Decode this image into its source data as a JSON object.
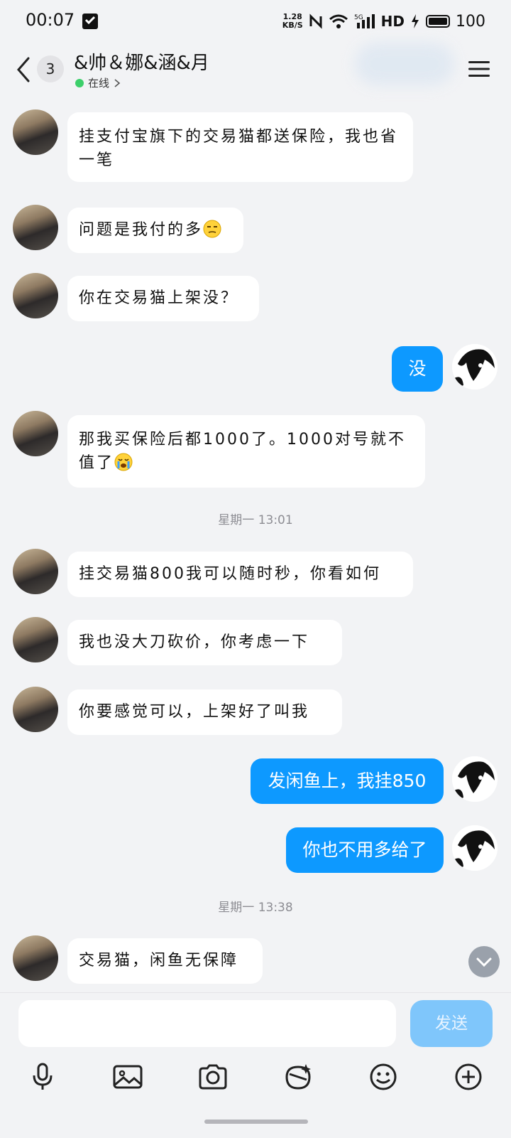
{
  "status_bar": {
    "time": "00:07",
    "net_speed_value": "1.28",
    "net_speed_unit": "KB/S",
    "network": "5G",
    "hd": "HD",
    "battery": "100"
  },
  "header": {
    "back_count": "3",
    "title": "&帅＆娜&涵&月",
    "presence": "在线",
    "status_color": "#3ccf6a"
  },
  "messages": [
    {
      "side": "in",
      "text": "挂支付宝旗下的交易猫都送保险，我也省一笔"
    },
    {
      "side": "in",
      "text": "问题是我付的多",
      "emoji": "smirk-emoji"
    },
    {
      "side": "in",
      "text": "你在交易猫上架没？"
    },
    {
      "side": "out",
      "text": "没"
    },
    {
      "side": "in",
      "text": "那我买保险后都1000了。1000对号就不值了",
      "emoji": "crying-emoji"
    },
    {
      "side": "in",
      "text": "挂交易猫800我可以随时秒，你看如何"
    },
    {
      "side": "in",
      "text": "我也没大刀砍价，你考虑一下"
    },
    {
      "side": "in",
      "text": "你要感觉可以，上架好了叫我"
    },
    {
      "side": "out",
      "text": "发闲鱼上，我挂850"
    },
    {
      "side": "out",
      "text": "你也不用多给了"
    },
    {
      "side": "in",
      "text": "交易猫，闲鱼无保障"
    }
  ],
  "timestamps": [
    "星期一 13:01",
    "星期一 13:38"
  ],
  "composer": {
    "send_label": "发送",
    "input_value": ""
  },
  "toolbar_icons": [
    "microphone-icon",
    "image-icon",
    "camera-icon",
    "sticker-icon",
    "emoji-icon",
    "plus-icon"
  ],
  "colors": {
    "outgoing_bubble": "#0d99ff",
    "incoming_bubble": "#ffffff",
    "background": "#f2f3f5",
    "send_button": "#7fc6fb"
  }
}
